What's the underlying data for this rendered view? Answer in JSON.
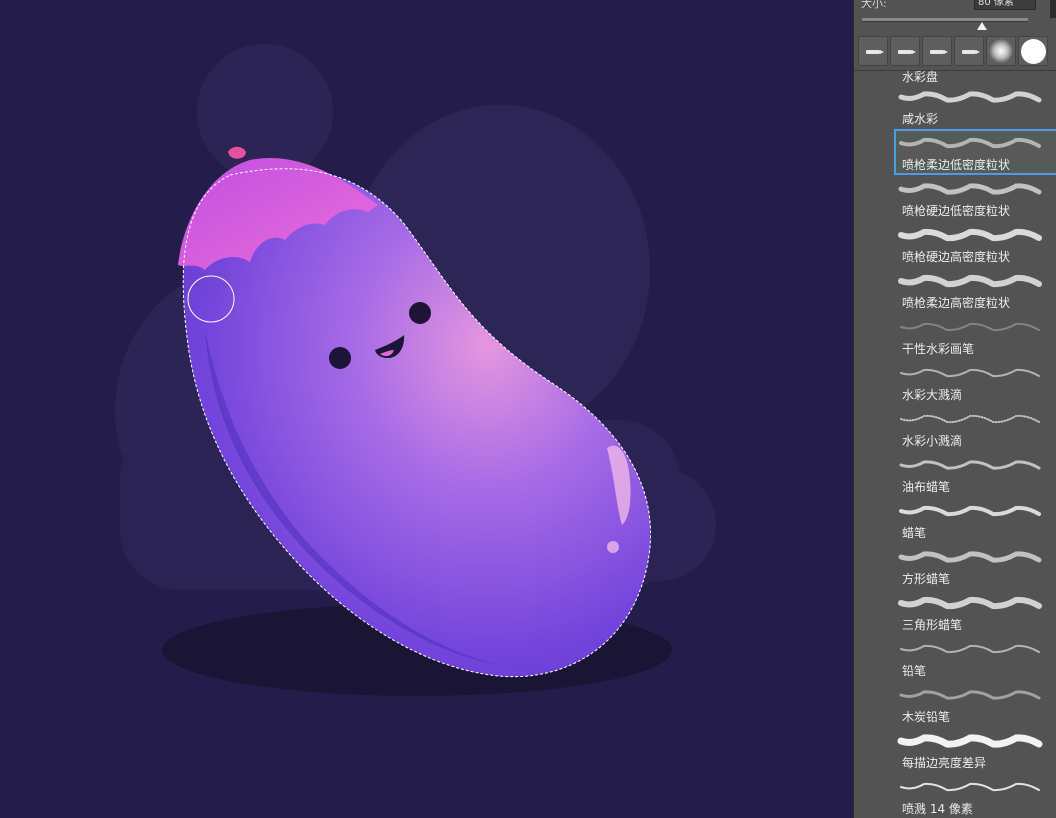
{
  "brush_panel": {
    "size_label": "大小:",
    "size_value": "80 像素",
    "size_slider_level": 0.72,
    "brush_tips": [
      {
        "icon": "pen-tip-icon"
      },
      {
        "icon": "pen-tip-icon"
      },
      {
        "icon": "pen-tip-icon"
      },
      {
        "icon": "pen-tip-icon"
      },
      {
        "icon": "soft-round-brush-icon"
      },
      {
        "icon": "hard-round-brush-icon"
      }
    ],
    "brushes": [
      {
        "name": "水彩盘"
      },
      {
        "name": "咸水彩"
      },
      {
        "name": "喷枪柔边低密度粒状",
        "selected": true
      },
      {
        "name": "喷枪硬边低密度粒状"
      },
      {
        "name": "喷枪硬边高密度粒状"
      },
      {
        "name": "喷枪柔边高密度粒状"
      },
      {
        "name": "干性水彩画笔"
      },
      {
        "name": "水彩大溅滴"
      },
      {
        "name": "水彩小溅滴"
      },
      {
        "name": "油布蜡笔"
      },
      {
        "name": "蜡笔"
      },
      {
        "name": "方形蜡笔"
      },
      {
        "name": "三角形蜡笔"
      },
      {
        "name": "铅笔"
      },
      {
        "name": "木炭铅笔"
      },
      {
        "name": "每描边亮度差异"
      },
      {
        "name": "喷溅 14 像素"
      }
    ]
  },
  "canvas": {
    "background_color": "#241d4b",
    "subject": "eggplant character illustration with marching-ants selection",
    "colors": {
      "body": "#7a4ae0",
      "cap": "#e064d8",
      "highlight": "#e79adf",
      "shadow": "#191433"
    }
  }
}
